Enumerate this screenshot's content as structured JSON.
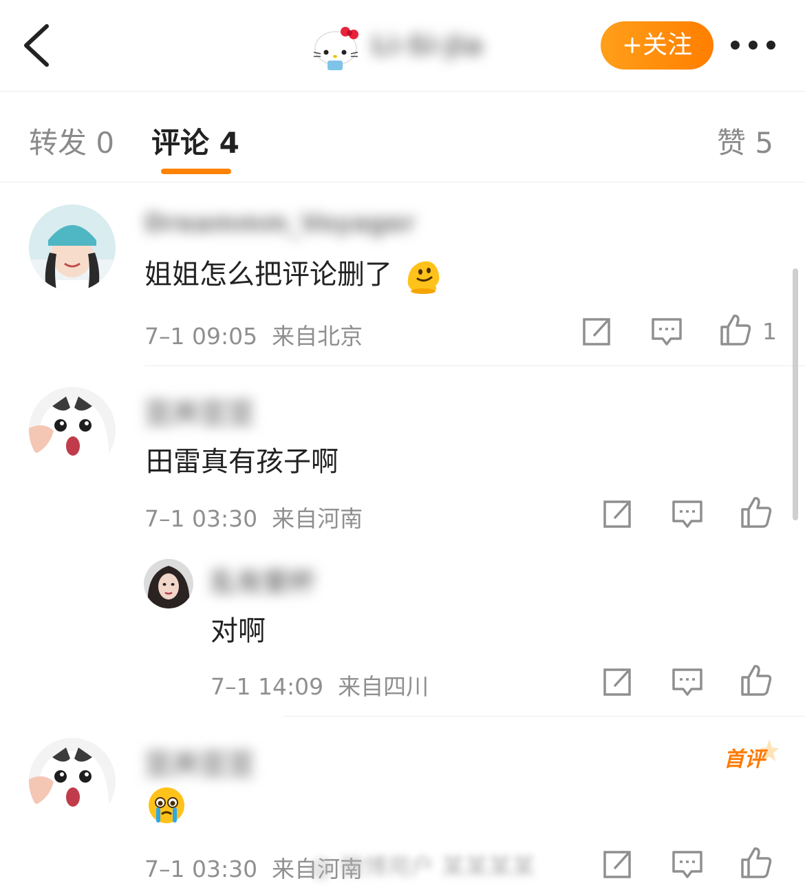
{
  "header": {
    "author_name": "Li-Si-Jia",
    "follow_label": "+关注"
  },
  "tabs": [
    {
      "label": "转发 0"
    },
    {
      "label": "评论 4"
    },
    {
      "label": "赞 5"
    }
  ],
  "comments": [
    {
      "username": "Dreammm_Voyager",
      "text": "姐姐怎么把评论删了",
      "emoji": "melting-face",
      "time": "7–1 09:05",
      "location": "来自北京",
      "likes": "1"
    },
    {
      "username": "豆丼豆豆",
      "text": "田雷真有孩子啊",
      "time": "7–1 03:30",
      "location": "来自河南",
      "likes": "",
      "reply": {
        "username": "乱有爱杯",
        "text": "对啊",
        "time": "7–1 14:09",
        "location": "来自四川"
      }
    },
    {
      "username": "豆丼豆豆",
      "text": "",
      "emoji": "crying-face",
      "badge": "首评",
      "time": "7–1 03:30",
      "location": "来自河南",
      "likes": ""
    }
  ],
  "watermark": "@ 微博用户 某某某某",
  "colors": {
    "accent": "#ff8200",
    "follow_gradient_start": "#ff9f1a",
    "follow_gradient_end": "#ff7e00",
    "meta_text": "#8f8f8f"
  }
}
